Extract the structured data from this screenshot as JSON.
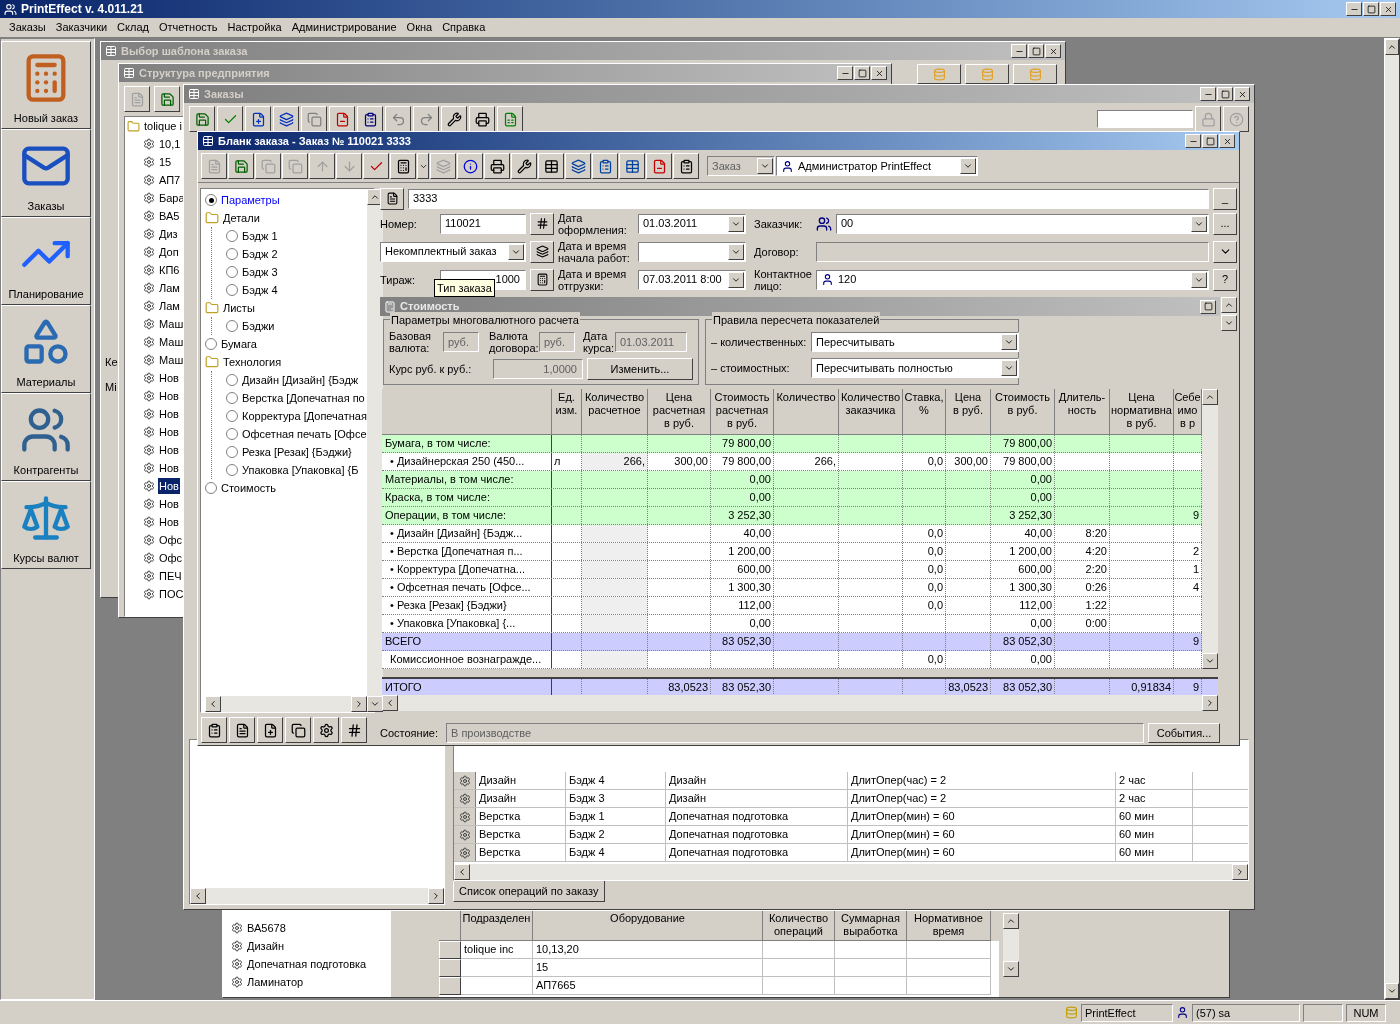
{
  "app": {
    "title": "PrintEffect v. 4.011.21",
    "status": [
      "PrintEffect",
      "(57) sa",
      "NUM"
    ]
  },
  "menu": [
    "Заказы",
    "Заказчики",
    "Склад",
    "Отчетность",
    "Настройка",
    "Администрирование",
    "Окна",
    "Справка"
  ],
  "sidebar": [
    {
      "label": "Новый заказ",
      "kind": "calculator"
    },
    {
      "label": "Заказы",
      "kind": "mail"
    },
    {
      "label": "Планирование",
      "kind": "chart"
    },
    {
      "label": "Материалы",
      "kind": "shapes"
    },
    {
      "label": "Контрагенты",
      "kind": "people"
    },
    {
      "label": "Курсы валют",
      "kind": "scales"
    }
  ],
  "template_window": {
    "title": "Выбор шаблона заказа",
    "active": false,
    "cut_labels": [
      "Ке",
      "Mi"
    ]
  },
  "structure_window": {
    "title": "Структура предприятия",
    "active": false,
    "root": "tolique i",
    "items": [
      {
        "label": "10,1",
        "selected": false
      },
      {
        "label": "15",
        "selected": false
      },
      {
        "label": "АП7",
        "selected": false
      },
      {
        "label": "Бара",
        "selected": false
      },
      {
        "label": "ВА5",
        "selected": false
      },
      {
        "label": "Диз",
        "selected": false
      },
      {
        "label": "Доп",
        "selected": false
      },
      {
        "label": "КП6",
        "selected": false
      },
      {
        "label": "Лам",
        "selected": false
      },
      {
        "label": "Лам",
        "selected": false
      },
      {
        "label": "Маш",
        "selected": false
      },
      {
        "label": "Маш",
        "selected": false
      },
      {
        "label": "Маш",
        "selected": false
      },
      {
        "label": "Нов",
        "selected": false
      },
      {
        "label": "Нов",
        "selected": false
      },
      {
        "label": "Нов",
        "selected": false
      },
      {
        "label": "Нов",
        "selected": false
      },
      {
        "label": "Нов",
        "selected": false
      },
      {
        "label": "Нов",
        "selected": false
      },
      {
        "label": "Нов",
        "selected": true
      },
      {
        "label": "Нов",
        "selected": false
      },
      {
        "label": "Нов",
        "selected": false
      },
      {
        "label": "Офс",
        "selected": false
      },
      {
        "label": "Офс",
        "selected": false
      },
      {
        "label": "ПЕЧ",
        "selected": false
      },
      {
        "label": "ПОС",
        "selected": false
      }
    ]
  },
  "lower_window": {
    "tree": [
      "ВА5678",
      "Дизайн",
      "Допечатная подготовка",
      "Ламинатор"
    ],
    "columns": [
      "Подразделен",
      "Оборудование",
      "Количество\nопераций",
      "Суммарная\nвыработка",
      "Нормативное\nвремя"
    ],
    "rows": [
      {
        "column_1": "tolique inc",
        "column_2": "10,13,20"
      },
      {
        "column_2": "15"
      },
      {
        "column_2": "АП7665"
      }
    ]
  },
  "orders_window": {
    "title": "Заказы",
    "active": false,
    "tab": "Список операций по заказу",
    "operations": [
      {
        "operation": "Дизайн",
        "detail": "Бэдж 4",
        "section": "Дизайн",
        "formula": "ДлитОпер(час) = 2",
        "duration": "2 час"
      },
      {
        "operation": "Дизайн",
        "detail": "Бэдж 3",
        "section": "Дизайн",
        "formula": "ДлитОпер(час) = 2",
        "duration": "2 час"
      },
      {
        "operation": "Верстка",
        "detail": "Бэдж 1",
        "section": "Допечатная подготовка",
        "formula": "ДлитОпер(мин) = 60",
        "duration": "60 мин"
      },
      {
        "operation": "Верстка",
        "detail": "Бэдж 2",
        "section": "Допечатная подготовка",
        "formula": "ДлитОпер(мин) = 60",
        "duration": "60 мин"
      },
      {
        "operation": "Верстка",
        "detail": "Бэдж 4",
        "section": "Допечатная подготовка",
        "formula": "ДлитОпер(мин) = 60",
        "duration": "60 мин"
      }
    ]
  },
  "order_window": {
    "title": "Бланк заказа - Заказ № 110021 3333",
    "active": true,
    "doc_type": {
      "value": "Заказ",
      "disabled": true
    },
    "user": "Администратор PrintEffect",
    "tree": [
      {
        "label": "Параметры",
        "kind": "radio",
        "selected": true
      },
      {
        "label": "Детали",
        "kind": "folder",
        "children": [
          {
            "label": "Бэдж 1",
            "kind": "radio",
            "selected": false
          },
          {
            "label": "Бэдж 2",
            "kind": "radio",
            "selected": false
          },
          {
            "label": "Бэдж 3",
            "kind": "radio",
            "selected": false
          },
          {
            "label": "Бэдж 4",
            "kind": "radio",
            "selected": false
          }
        ]
      },
      {
        "label": "Листы",
        "kind": "folder",
        "children": [
          {
            "label": "Бэджи",
            "kind": "radio",
            "selected": false
          }
        ]
      },
      {
        "label": "Бумага",
        "kind": "radio",
        "selected": false
      },
      {
        "label": "Технология",
        "kind": "folder",
        "children": [
          {
            "label": "Дизайн [Дизайн] {Бэдж",
            "kind": "radio",
            "selected": false
          },
          {
            "label": "Верстка [Допечатная по",
            "kind": "radio",
            "selected": false
          },
          {
            "label": "Корректура [Допечатная",
            "kind": "radio",
            "selected": false
          },
          {
            "label": "Офсетная печать [Офсе",
            "kind": "radio",
            "selected": false
          },
          {
            "label": "Резка [Резак] {Бэджи}",
            "kind": "radio",
            "selected": false
          },
          {
            "label": "Упаковка [Упаковка] {Б",
            "kind": "radio",
            "selected": false
          }
        ]
      },
      {
        "label": "Стоимость",
        "kind": "radio",
        "selected": false
      }
    ],
    "name": "3333",
    "name_button": "_",
    "number": {
      "label": "Номер:",
      "value": "110021"
    },
    "created": {
      "label": "Дата\nоформления:",
      "value": "01.03.2011"
    },
    "customer": {
      "label": "Заказчик:",
      "value": "00",
      "button": "..."
    },
    "order_kind": "Некомплектный заказ",
    "start": {
      "label": "Дата и время\nначала работ:"
    },
    "contract": {
      "label": "Договор:",
      "disabled": true
    },
    "run": {
      "label": "Тираж:",
      "value": "1000",
      "tooltip": "Тип заказа"
    },
    "ship": {
      "label": "Дата и время\nотгрузки:",
      "value": "07.03.2011 8:00"
    },
    "contact": {
      "label": "Контактное\nлицо:",
      "value": "120",
      "button": "?"
    },
    "cost": {
      "title": "Стоимость",
      "currency": {
        "title": "Параметры многовалютного расчета",
        "base_label": "Базовая\nвалюта:",
        "base": "руб.",
        "contract_label": "Валюта\nдоговора:",
        "contract": "руб.",
        "date_label": "Дата\nкурса:",
        "date": "01.03.2011",
        "rate_label": "Курс руб. к руб.:",
        "rate": "1,0000",
        "change_button": "Изменить..."
      },
      "rules": {
        "title": "Правила пересчета показателей",
        "qty_label": "– количественных:",
        "qty": "Пересчитывать",
        "cost_label": "– стоимостных:",
        "cost": "Пересчитывать полностью"
      },
      "columns": [
        {
          "label": "Ед.\nизм.",
          "shaded": false
        },
        {
          "label": "Количество\nрасчетное",
          "shaded": true
        },
        {
          "label": "Цена\nрасчетная\nв руб.",
          "shaded": false
        },
        {
          "label": "Стоимость\nрасчетная\nв руб.",
          "shaded": false
        },
        {
          "label": "Количество",
          "shaded": false
        },
        {
          "label": "Количество\nзаказчика",
          "shaded": false
        },
        {
          "label": "Ставка,\n%",
          "shaded": false
        },
        {
          "label": "Цена\nв руб.",
          "shaded": false
        },
        {
          "label": "Стоимость\nв руб.",
          "shaded": false
        },
        {
          "label": "Длитель-\nность",
          "shaded": false
        },
        {
          "label": "Цена\nнормативна\nв руб.",
          "shaded": false
        },
        {
          "label": "Себе\nимо\nв р",
          "shaded": false
        }
      ],
      "rows": [
        {
          "kind": "group",
          "label": "Бумага, в том числе:",
          "values": {
            "column_5": "79 800,00",
            "column_10": "79 800,00"
          }
        },
        {
          "kind": "item",
          "label": "• Дизайнерская 250 (450...",
          "values": {
            "column_2": "л",
            "column_3": "266,",
            "column_4": "300,00",
            "column_5": "79 800,00",
            "column_6": "266,",
            "column_8": "0,0",
            "column_9": "300,00",
            "column_10": "79 800,00"
          }
        },
        {
          "kind": "group",
          "label": "Материалы, в том числе:",
          "values": {
            "column_5": "0,00",
            "column_10": "0,00"
          }
        },
        {
          "kind": "group",
          "label": "Краска, в том числе:",
          "values": {
            "column_5": "0,00",
            "column_10": "0,00"
          }
        },
        {
          "kind": "group",
          "label": "Операции, в том числе:",
          "values": {
            "column_5": "3 252,30",
            "column_10": "3 252,30",
            "column_13": "9"
          }
        },
        {
          "kind": "item",
          "label": "• Дизайн [Дизайн] {Бэдж...",
          "values": {
            "column_5": "40,00",
            "column_8": "0,0",
            "column_10": "40,00",
            "column_11": "8:20"
          }
        },
        {
          "kind": "item",
          "label": "• Верстка [Допечатная п...",
          "values": {
            "column_5": "1 200,00",
            "column_8": "0,0",
            "column_10": "1 200,00",
            "column_11": "4:20",
            "column_13": "2"
          }
        },
        {
          "kind": "item",
          "label": "• Корректура [Допечатна...",
          "values": {
            "column_5": "600,00",
            "column_8": "0,0",
            "column_10": "600,00",
            "column_11": "2:20",
            "column_13": "1"
          }
        },
        {
          "kind": "item",
          "label": "• Офсетная печать [Офсе...",
          "values": {
            "column_5": "1 300,30",
            "column_8": "0,0",
            "column_10": "1 300,30",
            "column_11": "0:26",
            "column_13": "4"
          }
        },
        {
          "kind": "item",
          "label": "• Резка [Резак] {Бэджи}",
          "values": {
            "column_5": "112,00",
            "column_8": "0,0",
            "column_10": "112,00",
            "column_11": "1:22"
          }
        },
        {
          "kind": "item",
          "label": "• Упаковка [Упаковка] {...",
          "values": {
            "column_5": "0,00",
            "column_10": "0,00",
            "column_11": "0:00"
          }
        },
        {
          "kind": "total",
          "label": "ВСЕГО",
          "values": {
            "column_5": "83 052,30",
            "column_10": "83 052,30",
            "column_13": "9"
          }
        },
        {
          "kind": "item",
          "label": "Комиссионное вознагражде...",
          "values": {
            "column_8": "0,0",
            "column_10": "0,00"
          }
        }
      ],
      "total": {
        "label": "ИТОГО",
        "values": {
          "column_4": "83,0523",
          "column_5": "83 052,30",
          "column_9": "83,0523",
          "column_10": "83 052,30",
          "column_12": "0,91834",
          "column_13": "9"
        }
      }
    },
    "status_label": "Состояние:",
    "status": "В производстве",
    "events_button": "События..."
  }
}
